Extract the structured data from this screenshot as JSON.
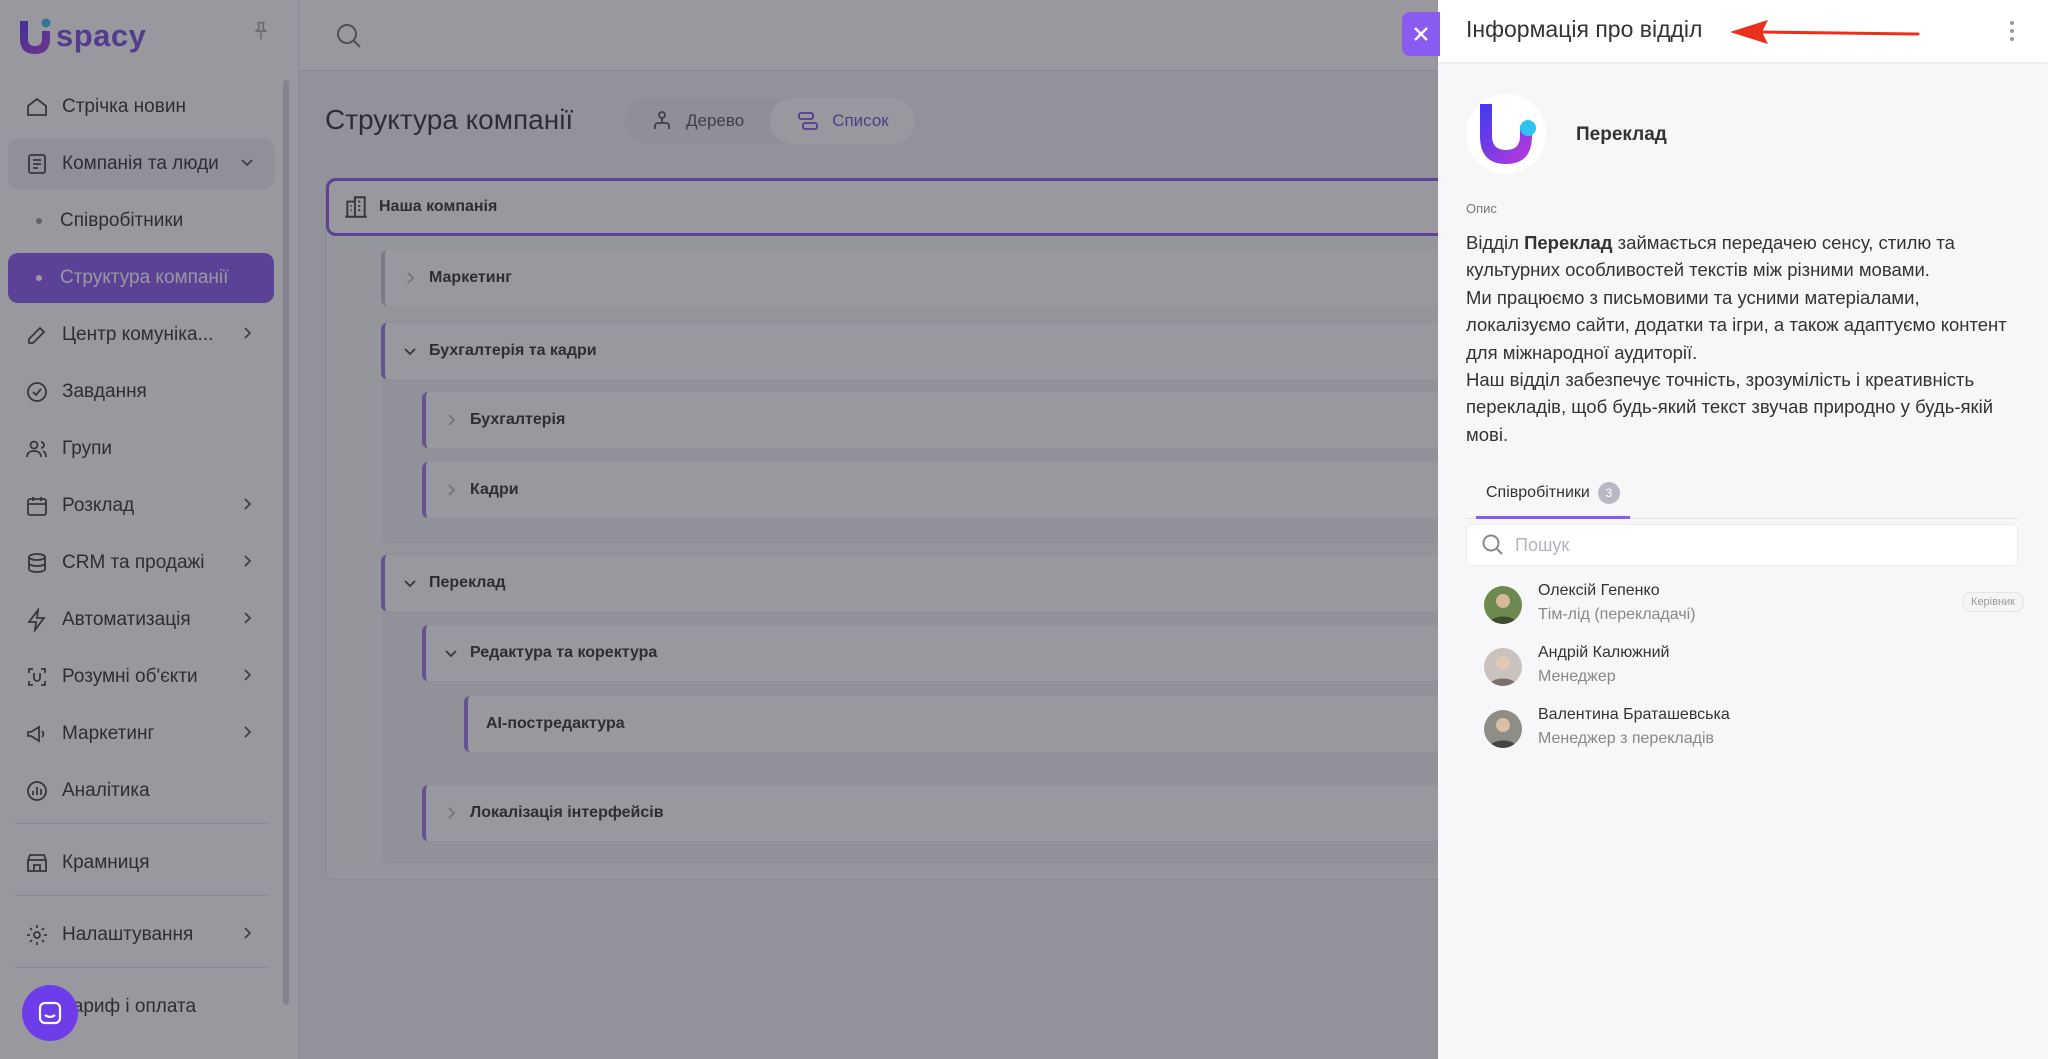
{
  "app": {
    "logo_text": "spacy"
  },
  "sidebar": {
    "items": [
      {
        "label": "Стрічка новин",
        "icon": "newspaper-icon"
      },
      {
        "label": "Компанія та люди",
        "icon": "company-icon",
        "expanded": true
      },
      {
        "label": "Співробітники",
        "sub": true
      },
      {
        "label": "Структура компанії",
        "sub": true,
        "active": true
      },
      {
        "label": "Центр комуніка...",
        "icon": "chat-edit-icon",
        "has_children": true
      },
      {
        "label": "Завдання",
        "icon": "check-circle-icon"
      },
      {
        "label": "Групи",
        "icon": "users-icon"
      },
      {
        "label": "Розклад",
        "icon": "calendar-icon",
        "has_children": true
      },
      {
        "label": "CRM та продажі",
        "icon": "database-icon",
        "has_children": true
      },
      {
        "label": "Автоматизація",
        "icon": "lightning-icon",
        "has_children": true
      },
      {
        "label": "Розумні об'єкти",
        "icon": "smart-object-icon",
        "has_children": true
      },
      {
        "label": "Маркетинг",
        "icon": "megaphone-icon",
        "has_children": true
      },
      {
        "label": "Аналітика",
        "icon": "chart-icon"
      },
      {
        "label": "Крамниця",
        "icon": "store-icon"
      },
      {
        "label": "Налаштування",
        "icon": "gear-icon",
        "has_children": true
      },
      {
        "label": "Тариф і оплата",
        "icon": "card-icon"
      }
    ]
  },
  "main": {
    "title": "Структура компанії",
    "view_tabs": [
      {
        "label": "Дерево",
        "icon": "tree-icon"
      },
      {
        "label": "Список",
        "icon": "list-icon",
        "active": true
      }
    ],
    "root": "Наша компанія",
    "departments": [
      {
        "label": "Маркетинг"
      },
      {
        "label": "Бухгалтерія та кадри"
      },
      {
        "label": "Бухгалтерія"
      },
      {
        "label": "Кадри"
      },
      {
        "label": "Переклад"
      },
      {
        "label": "Редактура та коректура"
      },
      {
        "label": "AI-постредактура"
      },
      {
        "label": "Локалізація інтерфейсів"
      }
    ]
  },
  "panel": {
    "title": "Інформація про відділ",
    "department_name": "Переклад",
    "description_label": "Опис",
    "description": {
      "p1_prefix": "Відділ ",
      "p1_bold": "Переклад",
      "p1_suffix": " займається передачею сенсу, стилю та культурних особливостей текстів між різними мовами.",
      "p2": "Ми працюємо з письмовими та усними матеріалами, локалізуємо сайти, додатки та ігри, а також адаптуємо контент для міжнародної аудиторії.",
      "p3": "Наш відділ забезпечує точність, зрозумілість і креативність перекладів, щоб будь-який текст звучав природно у будь-якій мові."
    },
    "tab_label": "Співробітники",
    "tab_count": "3",
    "search_placeholder": "Пошук",
    "employees": [
      {
        "name": "Олексій Гепенко",
        "role": "Тім-лід (перекладачі)",
        "badge": "Керівник"
      },
      {
        "name": "Андрій Калюжний",
        "role": "Менеджер"
      },
      {
        "name": "Валентина Браташевська",
        "role": "Менеджер з перекладів"
      }
    ]
  },
  "colors": {
    "accent": "#8a5bf0",
    "arrow": "#e8301c"
  }
}
